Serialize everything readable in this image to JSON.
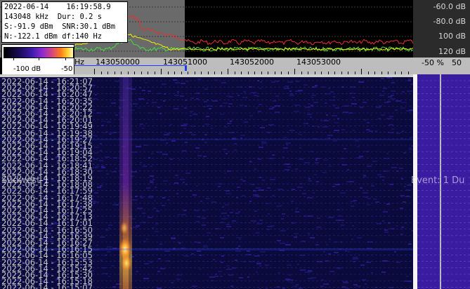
{
  "info": {
    "date": "2022-06-14",
    "time": "16:19:58.9",
    "freq": "143048 kHz",
    "duration": "Dur: 0.2 s",
    "signal": "S:-91.9 dBm",
    "snr": "SNR:30.1 dBm",
    "noise": "N:-122.1 dBm",
    "df": "df:140 Hz"
  },
  "legend": {
    "left": "-100 dB",
    "right": "-50"
  },
  "db_scale": [
    "-60.0 dB",
    "-80.0 dB",
    "100 dB",
    "120 dB"
  ],
  "freq_axis": {
    "unit": "Hz",
    "labels": [
      "143050000",
      "143051000",
      "143052000",
      "143053000"
    ]
  },
  "pct_axis": [
    "-50 %",
    "50"
  ],
  "timestamps": [
    "2022-06-14 - 16:21:07",
    "2022-06-14 - 16:20:57",
    "2022-06-14 - 16:20:47",
    "2022-06-14 - 16:20:35",
    "2022-06-14 - 16:20:22",
    "2022-06-14 - 16:20:12",
    "2022-06-14 - 16:20:01",
    "2022-06-14 - 16:19:49",
    "2022-06-14 - 16:19:38",
    "2022-06-14 - 16:19:27",
    "2022-06-14 - 16:19:15",
    "2022-06-14 - 16:19:04",
    "2022-06-14 - 16:18:52",
    "2022-06-14 - 16:18:41",
    "2022-06-14 - 16:18:30",
    "2022-06-14 - 16:18:19",
    "2022-06-14 - 16:18:08",
    "2022-06-14 - 16:17:59",
    "2022-06-14 - 16:17:48",
    "2022-06-14 - 16:17:38",
    "2022-06-14 - 16:17:25",
    "2022-06-14 - 16:17:13",
    "2022-06-14 - 16:17:01",
    "2022-06-14 - 16:16:50",
    "2022-06-14 - 16:16:39",
    "2022-06-14 - 16:16:27",
    "2022-06-14 - 16:16:15",
    "2022-06-14 - 16:16:05",
    "2022-06-14 - 16:15:53",
    "2022-06-14 - 16:15:42",
    "2022-06-14 - 16:15:30",
    "2022-06-14 - 16:15:18",
    "2022-06-14 - 16:15:07"
  ],
  "overlay": {
    "meteor_label": "Südwest-1",
    "event_label": "Event: 1   Du"
  },
  "colors": {
    "spectrum_bg": "#5a5a5a",
    "noise_trace": "#e83030",
    "avg_trace": "#44dd44",
    "peak_trace": "#f2f200",
    "waterfall_bg": "#0a0a3c",
    "side_panel": "#3a1ca0",
    "marker": "#1a3cff"
  }
}
